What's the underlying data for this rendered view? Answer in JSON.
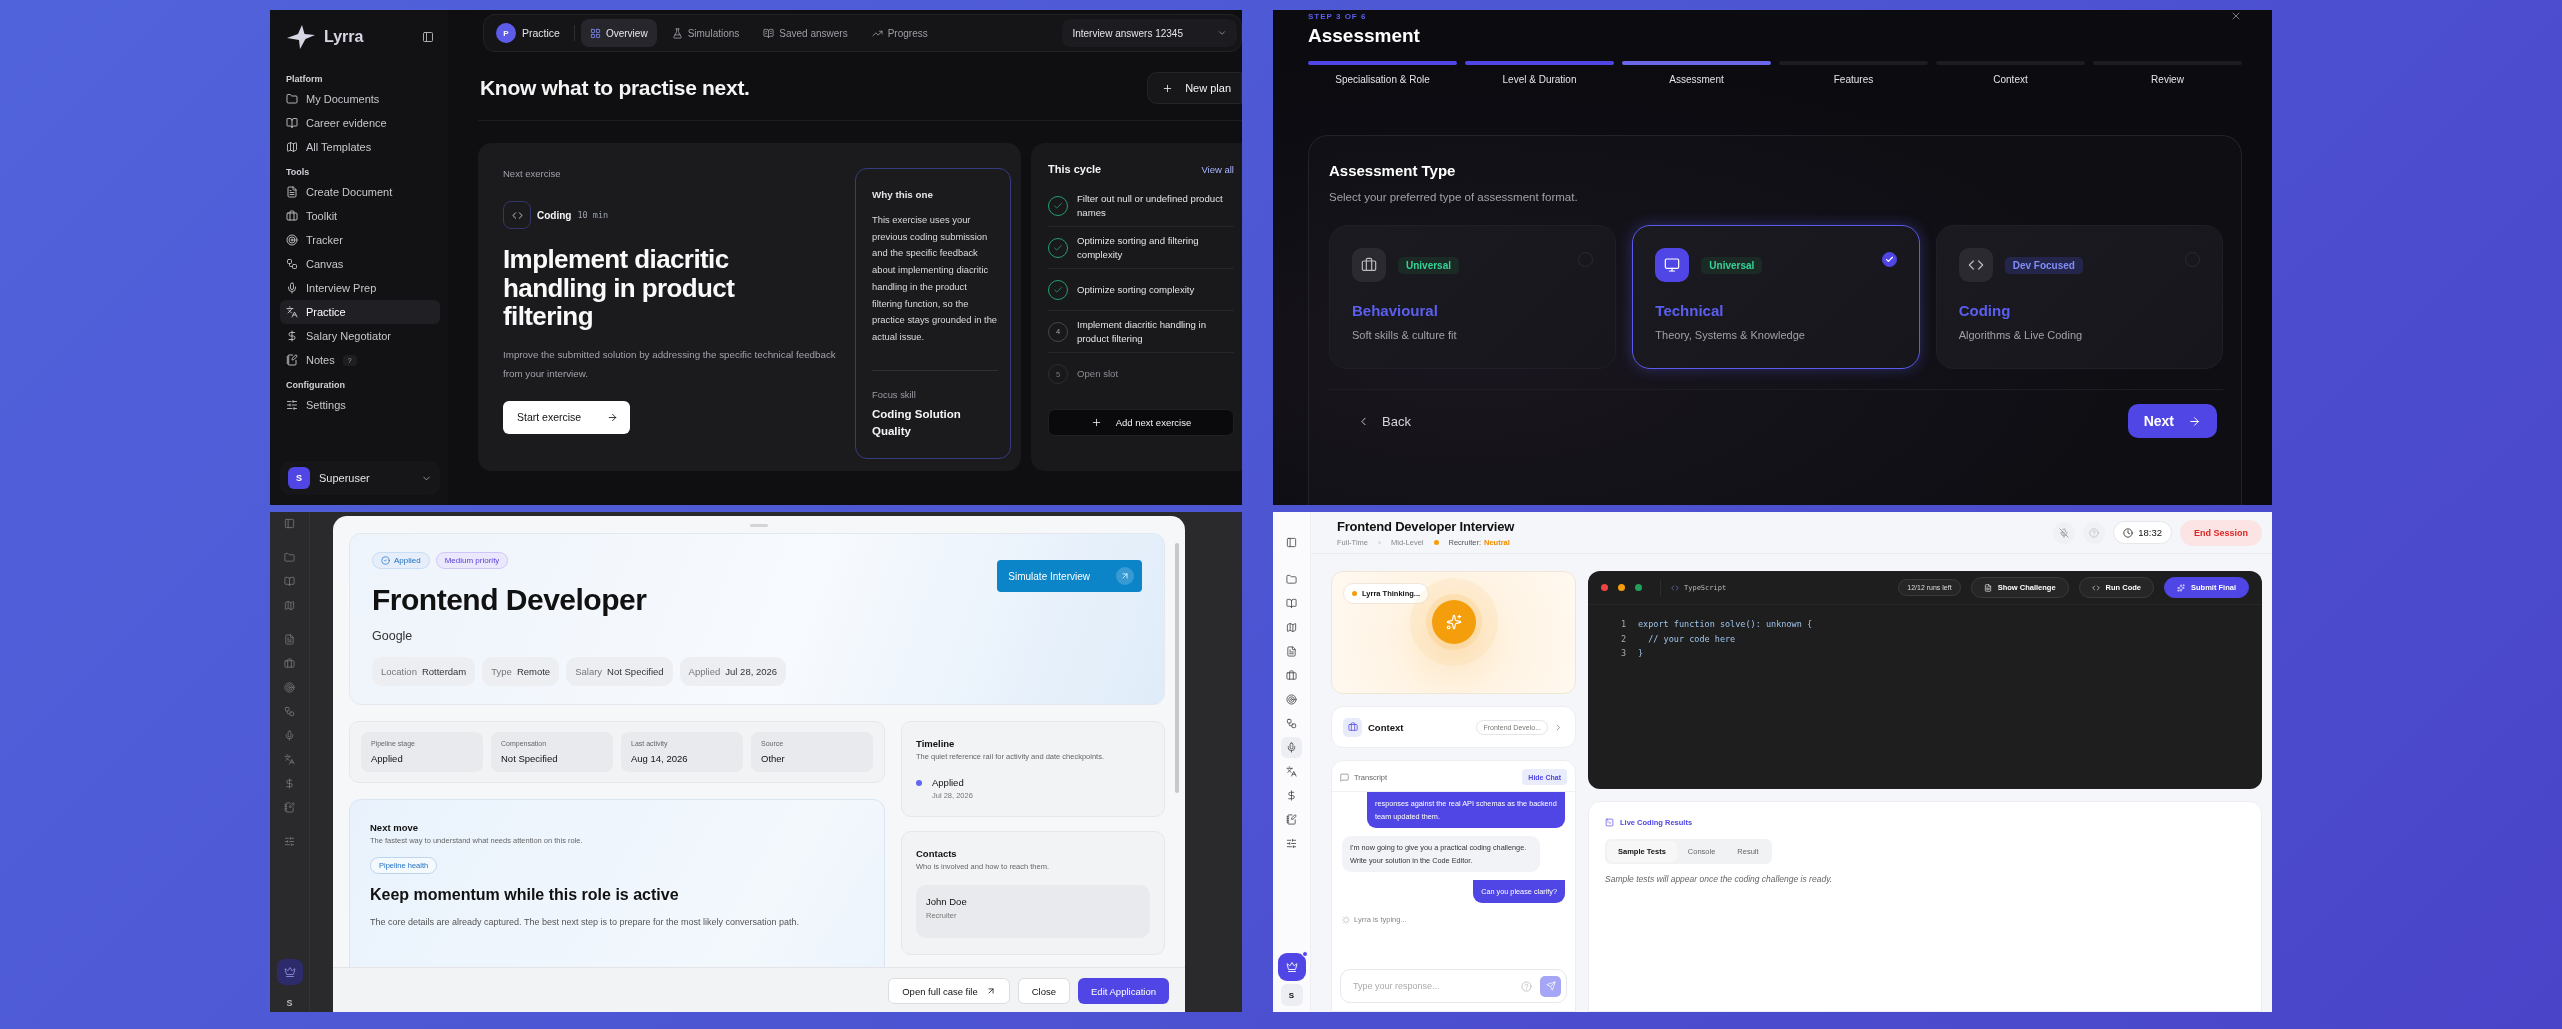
{
  "practice_app": {
    "brand": "Lyrra",
    "sidebar": {
      "sections": [
        {
          "title": "Platform",
          "items": [
            {
              "label": "My Documents",
              "selected": false
            },
            {
              "label": "Career evidence",
              "selected": false
            },
            {
              "label": "All Templates",
              "selected": false
            }
          ]
        },
        {
          "title": "Tools",
          "items": [
            {
              "label": "Create Document",
              "selected": false
            },
            {
              "label": "Toolkit",
              "selected": false
            },
            {
              "label": "Tracker",
              "selected": false
            },
            {
              "label": "Canvas",
              "selected": false
            },
            {
              "label": "Interview Prep",
              "selected": false
            },
            {
              "label": "Practice",
              "selected": true
            },
            {
              "label": "Salary Negotiator",
              "selected": false
            },
            {
              "label": "Notes",
              "badge": "?",
              "selected": false
            }
          ]
        },
        {
          "title": "Configuration",
          "items": [
            {
              "label": "Settings",
              "selected": false
            }
          ]
        }
      ],
      "user": {
        "initial": "S",
        "name": "Superuser"
      }
    },
    "topbar": {
      "initial": "P",
      "title": "Practice",
      "tabs": [
        {
          "label": "Overview",
          "selected": true
        },
        {
          "label": "Simulations",
          "selected": false
        },
        {
          "label": "Saved answers",
          "selected": false
        },
        {
          "label": "Progress",
          "selected": false
        }
      ],
      "select": "Interview answers 12345"
    },
    "heading": "Know what to practise next.",
    "new_plan": "New plan",
    "next_exercise": {
      "eyebrow": "Next exercise",
      "type": "Coding",
      "duration": "10 min",
      "title": "Implement diacritic handling in product filtering",
      "description": "Improve the submitted solution by addressing the specific technical feedback from your interview.",
      "button": "Start exercise"
    },
    "why": {
      "title": "Why this one",
      "body": "This exercise uses your previous coding submission and the specific feedback about implementing diacritic handling in the product filtering function, so the practice stays grounded in the actual issue.",
      "focus_label": "Focus skill",
      "focus_value": "Coding Solution Quality"
    },
    "cycle": {
      "title": "This cycle",
      "link": "View all",
      "items": [
        {
          "label": "Filter out null or undefined product names",
          "checked": true,
          "disabled": false
        },
        {
          "label": "Optimize sorting and filtering complexity",
          "checked": true,
          "disabled": false
        },
        {
          "label": "Optimize sorting complexity",
          "checked": true,
          "disabled": false
        },
        {
          "number": "4",
          "label": "Implement diacritic handling in product filtering",
          "checked": false,
          "disabled": false
        },
        {
          "number": "5",
          "label": "Open slot",
          "checked": false,
          "disabled": true
        }
      ],
      "button": "Add next exercise"
    }
  },
  "assessment_wizard": {
    "step": "STEP 3 OF 6",
    "title": "Assessment",
    "steps": [
      {
        "label": "Specialisation & Role",
        "completed": true,
        "selected": false
      },
      {
        "label": "Level & Duration",
        "completed": true,
        "selected": false
      },
      {
        "label": "Assessment",
        "completed": false,
        "selected": true
      },
      {
        "label": "Features",
        "completed": false,
        "selected": false
      },
      {
        "label": "Context",
        "completed": false,
        "selected": false
      },
      {
        "label": "Review",
        "completed": false,
        "selected": false
      }
    ],
    "card_title": "Assessment Type",
    "card_subtitle": "Select your preferred type of assessment format.",
    "options": [
      {
        "name": "Behavioural",
        "tag": "Universal",
        "kind": "universal",
        "description": "Soft skills & culture fit",
        "selected": false
      },
      {
        "name": "Technical",
        "tag": "Universal",
        "kind": "universal",
        "description": "Theory, Systems & Knowledge",
        "selected": true
      },
      {
        "name": "Coding",
        "tag": "Dev Focused",
        "kind": "dev",
        "description": "Algorithms & Live Coding",
        "selected": false
      }
    ],
    "back": "Back",
    "next": "Next"
  },
  "application_modal": {
    "rail_initial": "S",
    "tags": [
      {
        "label": "Applied",
        "kind": "status"
      },
      {
        "label": "Medium priority",
        "kind": "priority"
      }
    ],
    "simulate": "Simulate Interview",
    "title": "Frontend Developer",
    "company": "Google",
    "facts": [
      {
        "label": "Location",
        "value": "Rotterdam"
      },
      {
        "label": "Type",
        "value": "Remote"
      },
      {
        "label": "Salary",
        "value": "Not Specified"
      },
      {
        "label": "Applied",
        "value": "Jul 28, 2026"
      }
    ],
    "stats": [
      {
        "label": "Pipeline stage",
        "value": "Applied"
      },
      {
        "label": "Compensation",
        "value": "Not Specified"
      },
      {
        "label": "Last activity",
        "value": "Aug 14, 2026"
      },
      {
        "label": "Source",
        "value": "Other"
      }
    ],
    "next_move": {
      "title": "Next move",
      "subtitle": "The fastest way to understand what needs attention on this role.",
      "tag": "Pipeline health",
      "headline": "Keep momentum while this role is active",
      "body": "The core details are already captured. The best next step is to prepare for the most likely conversation path."
    },
    "timeline": {
      "title": "Timeline",
      "subtitle": "The quiet reference rail for activity and date checkpoints.",
      "events": [
        {
          "label": "Applied",
          "date": "Jul 28, 2026"
        }
      ]
    },
    "contacts": {
      "title": "Contacts",
      "subtitle": "Who is involved and how to reach them.",
      "people": [
        {
          "name": "John Doe",
          "role": "Recruiter"
        }
      ]
    },
    "footer": {
      "open": "Open full case file",
      "close": "Close",
      "edit": "Edit Application"
    }
  },
  "interview_session": {
    "rail_initial": "S",
    "title": "Frontend Developer Interview",
    "meta": [
      "Full-Time",
      "Mid-Level"
    ],
    "recruiter_label": "Recruiter:",
    "recruiter_mood": "Neutral",
    "timer": "18:32",
    "end": "End Session",
    "thinking": "Lyrra Thinking...",
    "context": {
      "title": "Context",
      "value": "Frontend Develo..."
    },
    "transcript": {
      "title": "Transcript",
      "toggle": "Hide Chat",
      "messages": [
        {
          "kind": "user",
          "text": "responses against the real API schemas as the backend team updated them."
        },
        {
          "kind": "ai",
          "text": "I'm now going to give you a practical coding challenge. Write your solution in the Code Editor."
        },
        {
          "kind": "user",
          "text": "Can you please clarify?"
        }
      ],
      "typing": "Lyrra is typing..."
    },
    "input_placeholder": "Type your response...",
    "editor": {
      "language": "TypeScript",
      "runs": "12/12 runs left",
      "show": "Show Challenge",
      "run": "Run Code",
      "submit": "Submit Final",
      "lines": [
        {
          "number": "1",
          "text": "export function solve(): unknown {"
        },
        {
          "number": "2",
          "text": "  // your code here"
        },
        {
          "number": "3",
          "text": "}"
        }
      ]
    },
    "results": {
      "title": "Live Coding Results",
      "tabs": [
        {
          "label": "Sample Tests",
          "selected": true
        },
        {
          "label": "Console",
          "selected": false
        },
        {
          "label": "Result",
          "selected": false
        }
      ],
      "empty": "Sample tests will appear once the coding challenge is ready."
    }
  }
}
